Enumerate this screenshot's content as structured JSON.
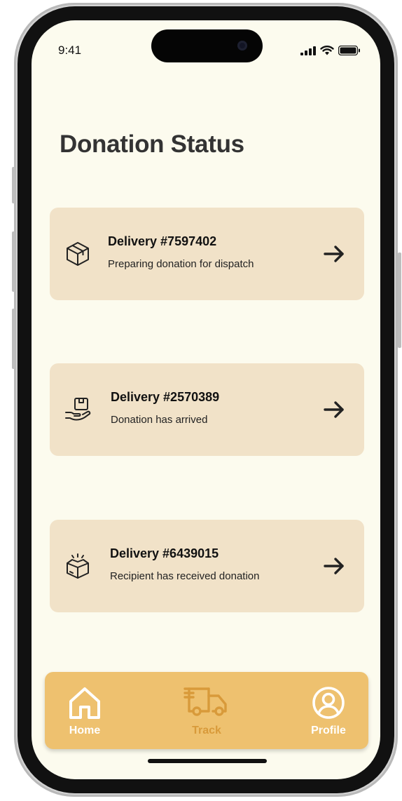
{
  "status_bar": {
    "time": "9:41"
  },
  "page": {
    "title": "Donation Status"
  },
  "deliveries": [
    {
      "title": "Delivery #7597402",
      "status": "Preparing donation for dispatch",
      "icon": "package-icon"
    },
    {
      "title": "Delivery #2570389",
      "status": "Donation has arrived",
      "icon": "hand-package-icon"
    },
    {
      "title": "Delivery #6439015",
      "status": "Recipient has received donation",
      "icon": "open-box-icon"
    }
  ],
  "tab_bar": {
    "home": {
      "label": "Home",
      "icon": "home-icon"
    },
    "track": {
      "label": "Track",
      "icon": "truck-icon",
      "active": true
    },
    "profile": {
      "label": "Profile",
      "icon": "user-circle-icon"
    }
  },
  "colors": {
    "background": "#fcfbee",
    "card": "#f1e2c8",
    "tab_bar": "#eec16f",
    "tab_active": "#d89a3a",
    "tab_inactive": "#ffffff"
  }
}
